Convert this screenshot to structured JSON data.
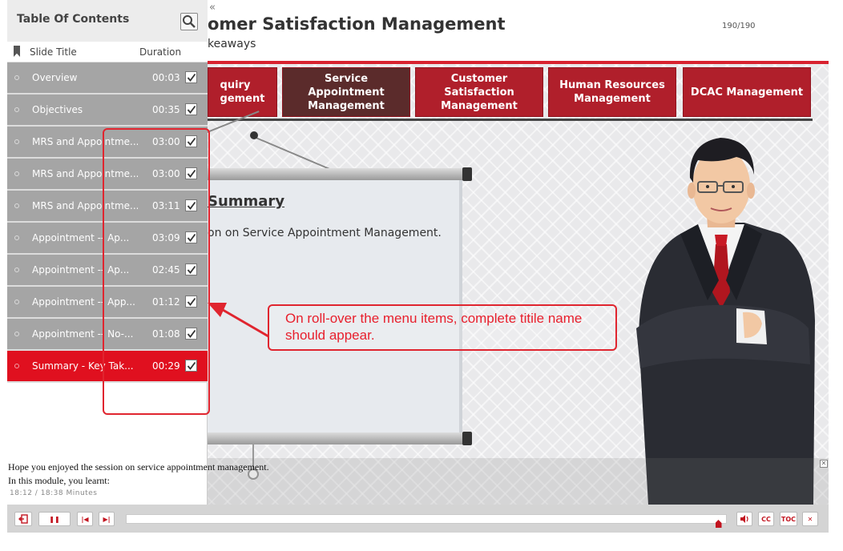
{
  "header": {
    "course_title": "omer Satisfaction Management",
    "subtitle": "keaways",
    "slide_counter": "190/190",
    "collapse_glyph": "«"
  },
  "module_tabs": [
    {
      "label": "quiry\ngement",
      "active": false
    },
    {
      "label": "Service Appointment Management",
      "active": true
    },
    {
      "label": "Customer Satisfaction Management",
      "active": false
    },
    {
      "label": "Human Resources Management",
      "active": false
    },
    {
      "label": "DCAC Management",
      "active": false
    }
  ],
  "slide": {
    "heading": "Summary",
    "body": "on on Service Appointment Management."
  },
  "toc": {
    "title": "Table Of Contents",
    "col_title": "Slide Title",
    "col_duration": "Duration",
    "items": [
      {
        "label": "Overview",
        "duration": "00:03",
        "done": true,
        "active": false
      },
      {
        "label": "Objectives",
        "duration": "00:35",
        "done": true,
        "active": false
      },
      {
        "label": "MRS and Appointme...",
        "duration": "03:00",
        "done": true,
        "active": false
      },
      {
        "label": "MRS and Appointme...",
        "duration": "03:00",
        "done": true,
        "active": false
      },
      {
        "label": "MRS and Appointme...",
        "duration": "03:11",
        "done": true,
        "active": false
      },
      {
        "label": "Appointment -- Ap...",
        "duration": "03:09",
        "done": true,
        "active": false
      },
      {
        "label": "Appointment -- Ap...",
        "duration": "02:45",
        "done": true,
        "active": false
      },
      {
        "label": "Appointment -- App...",
        "duration": "01:12",
        "done": true,
        "active": false
      },
      {
        "label": "Appointment -- No-...",
        "duration": "01:08",
        "done": true,
        "active": false
      },
      {
        "label": "Summary - Key Tak...",
        "duration": "00:29",
        "done": true,
        "active": true
      }
    ]
  },
  "transcript": {
    "line1": "Hope you enjoyed the session on service appointment management.",
    "line2": "In this module, you learnt:",
    "time_readout": "18:12 / 18:38 Minutes"
  },
  "controls": {
    "exit_icon": "exit-icon",
    "pause_glyph": "❚❚",
    "prev_glyph": "|◀",
    "next_glyph": "▶|",
    "volume_glyph": "🔊",
    "cc_label": "CC",
    "toc_label": "TOC",
    "close_glyph": "✕",
    "progress_fraction": 0.986
  },
  "annotation": {
    "text": "On roll-over the menu items, complete titile name should appear."
  },
  "colors": {
    "brand_red": "#b01f2b",
    "active_red": "#e0101f",
    "annotation_red": "#e0252f"
  }
}
